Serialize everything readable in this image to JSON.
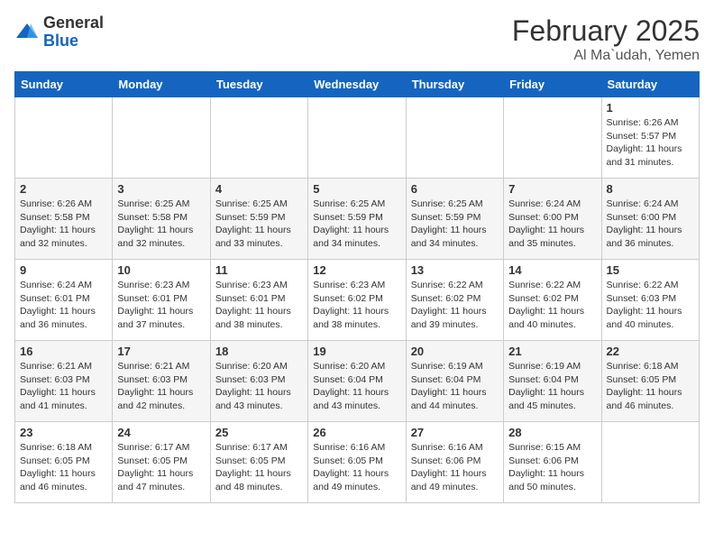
{
  "logo": {
    "general": "General",
    "blue": "Blue"
  },
  "header": {
    "month": "February 2025",
    "location": "Al Ma`udah, Yemen"
  },
  "weekdays": [
    "Sunday",
    "Monday",
    "Tuesday",
    "Wednesday",
    "Thursday",
    "Friday",
    "Saturday"
  ],
  "weeks": [
    [
      {
        "day": "",
        "info": ""
      },
      {
        "day": "",
        "info": ""
      },
      {
        "day": "",
        "info": ""
      },
      {
        "day": "",
        "info": ""
      },
      {
        "day": "",
        "info": ""
      },
      {
        "day": "",
        "info": ""
      },
      {
        "day": "1",
        "info": "Sunrise: 6:26 AM\nSunset: 5:57 PM\nDaylight: 11 hours and 31 minutes."
      }
    ],
    [
      {
        "day": "2",
        "info": "Sunrise: 6:26 AM\nSunset: 5:58 PM\nDaylight: 11 hours and 32 minutes."
      },
      {
        "day": "3",
        "info": "Sunrise: 6:25 AM\nSunset: 5:58 PM\nDaylight: 11 hours and 32 minutes."
      },
      {
        "day": "4",
        "info": "Sunrise: 6:25 AM\nSunset: 5:59 PM\nDaylight: 11 hours and 33 minutes."
      },
      {
        "day": "5",
        "info": "Sunrise: 6:25 AM\nSunset: 5:59 PM\nDaylight: 11 hours and 34 minutes."
      },
      {
        "day": "6",
        "info": "Sunrise: 6:25 AM\nSunset: 5:59 PM\nDaylight: 11 hours and 34 minutes."
      },
      {
        "day": "7",
        "info": "Sunrise: 6:24 AM\nSunset: 6:00 PM\nDaylight: 11 hours and 35 minutes."
      },
      {
        "day": "8",
        "info": "Sunrise: 6:24 AM\nSunset: 6:00 PM\nDaylight: 11 hours and 36 minutes."
      }
    ],
    [
      {
        "day": "9",
        "info": "Sunrise: 6:24 AM\nSunset: 6:01 PM\nDaylight: 11 hours and 36 minutes."
      },
      {
        "day": "10",
        "info": "Sunrise: 6:23 AM\nSunset: 6:01 PM\nDaylight: 11 hours and 37 minutes."
      },
      {
        "day": "11",
        "info": "Sunrise: 6:23 AM\nSunset: 6:01 PM\nDaylight: 11 hours and 38 minutes."
      },
      {
        "day": "12",
        "info": "Sunrise: 6:23 AM\nSunset: 6:02 PM\nDaylight: 11 hours and 38 minutes."
      },
      {
        "day": "13",
        "info": "Sunrise: 6:22 AM\nSunset: 6:02 PM\nDaylight: 11 hours and 39 minutes."
      },
      {
        "day": "14",
        "info": "Sunrise: 6:22 AM\nSunset: 6:02 PM\nDaylight: 11 hours and 40 minutes."
      },
      {
        "day": "15",
        "info": "Sunrise: 6:22 AM\nSunset: 6:03 PM\nDaylight: 11 hours and 40 minutes."
      }
    ],
    [
      {
        "day": "16",
        "info": "Sunrise: 6:21 AM\nSunset: 6:03 PM\nDaylight: 11 hours and 41 minutes."
      },
      {
        "day": "17",
        "info": "Sunrise: 6:21 AM\nSunset: 6:03 PM\nDaylight: 11 hours and 42 minutes."
      },
      {
        "day": "18",
        "info": "Sunrise: 6:20 AM\nSunset: 6:03 PM\nDaylight: 11 hours and 43 minutes."
      },
      {
        "day": "19",
        "info": "Sunrise: 6:20 AM\nSunset: 6:04 PM\nDaylight: 11 hours and 43 minutes."
      },
      {
        "day": "20",
        "info": "Sunrise: 6:19 AM\nSunset: 6:04 PM\nDaylight: 11 hours and 44 minutes."
      },
      {
        "day": "21",
        "info": "Sunrise: 6:19 AM\nSunset: 6:04 PM\nDaylight: 11 hours and 45 minutes."
      },
      {
        "day": "22",
        "info": "Sunrise: 6:18 AM\nSunset: 6:05 PM\nDaylight: 11 hours and 46 minutes."
      }
    ],
    [
      {
        "day": "23",
        "info": "Sunrise: 6:18 AM\nSunset: 6:05 PM\nDaylight: 11 hours and 46 minutes."
      },
      {
        "day": "24",
        "info": "Sunrise: 6:17 AM\nSunset: 6:05 PM\nDaylight: 11 hours and 47 minutes."
      },
      {
        "day": "25",
        "info": "Sunrise: 6:17 AM\nSunset: 6:05 PM\nDaylight: 11 hours and 48 minutes."
      },
      {
        "day": "26",
        "info": "Sunrise: 6:16 AM\nSunset: 6:05 PM\nDaylight: 11 hours and 49 minutes."
      },
      {
        "day": "27",
        "info": "Sunrise: 6:16 AM\nSunset: 6:06 PM\nDaylight: 11 hours and 49 minutes."
      },
      {
        "day": "28",
        "info": "Sunrise: 6:15 AM\nSunset: 6:06 PM\nDaylight: 11 hours and 50 minutes."
      },
      {
        "day": "",
        "info": ""
      }
    ]
  ]
}
